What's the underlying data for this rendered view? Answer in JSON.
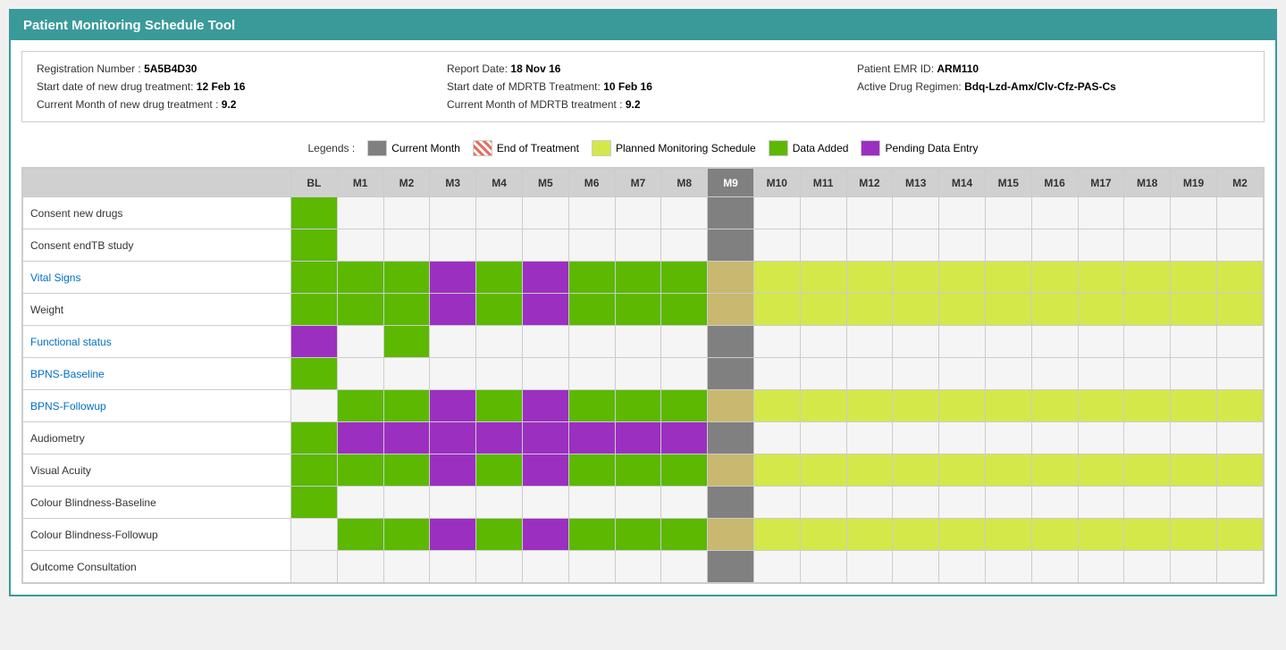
{
  "app": {
    "title": "Patient Monitoring Schedule Tool"
  },
  "info": {
    "registration_label": "Registration Number :",
    "registration_value": "5A5B4D30",
    "report_date_label": "Report Date:",
    "report_date_value": "18 Nov 16",
    "patient_emr_label": "Patient EMR ID:",
    "patient_emr_value": "ARM110",
    "start_new_drug_label": "Start date of new drug treatment:",
    "start_new_drug_value": "12 Feb 16",
    "start_mdrtb_label": "Start date of MDRTB Treatment:",
    "start_mdrtb_value": "10 Feb 16",
    "active_drug_label": "Active Drug Regimen:",
    "active_drug_value": "Bdq-Lzd-Amx/Clv-Cfz-PAS-Cs",
    "current_month_new_label": "Current Month of new drug treatment :",
    "current_month_new_value": "9.2",
    "current_month_mdrtb_label": "Current Month of MDRTB treatment :",
    "current_month_mdrtb_value": "9.2"
  },
  "legends": {
    "label": "Legends :",
    "items": [
      {
        "id": "current-month",
        "label": "Current Month",
        "class": "current-month"
      },
      {
        "id": "end-of-treatment",
        "label": "End of Treatment",
        "class": "end-of-treatment"
      },
      {
        "id": "planned",
        "label": "Planned Monitoring Schedule",
        "class": "planned"
      },
      {
        "id": "data-added",
        "label": "Data Added",
        "class": "data-added"
      },
      {
        "id": "pending",
        "label": "Pending Data Entry",
        "class": "pending"
      }
    ]
  },
  "columns": [
    "BL",
    "M1",
    "M2",
    "M3",
    "M4",
    "M5",
    "M6",
    "M7",
    "M8",
    "M9",
    "M10",
    "M11",
    "M12",
    "M13",
    "M14",
    "M15",
    "M16",
    "M17",
    "M18",
    "M19",
    "M2"
  ],
  "rows": [
    {
      "label": "Consent new drugs",
      "color": "black",
      "cells": [
        "green",
        "empty",
        "empty",
        "empty",
        "empty",
        "empty",
        "empty",
        "empty",
        "empty",
        "gray",
        "empty",
        "empty",
        "empty",
        "empty",
        "empty",
        "empty",
        "empty",
        "empty",
        "empty",
        "empty",
        "empty"
      ]
    },
    {
      "label": "Consent endTB study",
      "color": "black",
      "cells": [
        "green",
        "empty",
        "empty",
        "empty",
        "empty",
        "empty",
        "empty",
        "empty",
        "empty",
        "gray",
        "empty",
        "empty",
        "empty",
        "empty",
        "empty",
        "empty",
        "empty",
        "empty",
        "empty",
        "empty",
        "empty"
      ]
    },
    {
      "label": "Vital Signs",
      "color": "blue",
      "cells": [
        "green",
        "green",
        "green",
        "purple",
        "green",
        "purple",
        "green",
        "green",
        "green",
        "tan",
        "lime",
        "lime",
        "lime",
        "lime",
        "lime",
        "lime",
        "lime",
        "lime",
        "lime",
        "lime",
        "lime"
      ]
    },
    {
      "label": "Weight",
      "color": "black",
      "cells": [
        "green",
        "green",
        "green",
        "purple",
        "green",
        "purple",
        "green",
        "green",
        "green",
        "tan",
        "lime",
        "lime",
        "lime",
        "lime",
        "lime",
        "lime",
        "lime",
        "lime",
        "lime",
        "lime",
        "lime"
      ]
    },
    {
      "label": "Functional status",
      "color": "blue",
      "cells": [
        "purple",
        "empty",
        "green",
        "empty",
        "empty",
        "empty",
        "empty",
        "empty",
        "empty",
        "gray",
        "empty",
        "empty",
        "empty",
        "empty",
        "empty",
        "empty",
        "empty",
        "empty",
        "empty",
        "empty",
        "empty"
      ]
    },
    {
      "label": "BPNS-Baseline",
      "color": "blue",
      "cells": [
        "green",
        "empty",
        "empty",
        "empty",
        "empty",
        "empty",
        "empty",
        "empty",
        "empty",
        "gray",
        "empty",
        "empty",
        "empty",
        "empty",
        "empty",
        "empty",
        "empty",
        "empty",
        "empty",
        "empty",
        "empty"
      ]
    },
    {
      "label": "BPNS-Followup",
      "color": "blue",
      "cells": [
        "empty",
        "green",
        "green",
        "purple",
        "green",
        "purple",
        "green",
        "green",
        "green",
        "tan",
        "lime",
        "lime",
        "lime",
        "lime",
        "lime",
        "lime",
        "lime",
        "lime",
        "lime",
        "lime",
        "lime"
      ]
    },
    {
      "label": "Audiometry",
      "color": "black",
      "cells": [
        "green",
        "purple",
        "purple",
        "purple",
        "purple",
        "purple",
        "purple",
        "purple",
        "purple",
        "gray",
        "empty",
        "empty",
        "empty",
        "empty",
        "empty",
        "empty",
        "empty",
        "empty",
        "empty",
        "empty",
        "empty"
      ]
    },
    {
      "label": "Visual Acuity",
      "color": "black",
      "cells": [
        "green",
        "green",
        "green",
        "purple",
        "green",
        "purple",
        "green",
        "green",
        "green",
        "tan",
        "lime",
        "lime",
        "lime",
        "lime",
        "lime",
        "lime",
        "lime",
        "lime",
        "lime",
        "lime",
        "lime"
      ]
    },
    {
      "label": "Colour Blindness-Baseline",
      "color": "black",
      "cells": [
        "green",
        "empty",
        "empty",
        "empty",
        "empty",
        "empty",
        "empty",
        "empty",
        "empty",
        "gray",
        "empty",
        "empty",
        "empty",
        "empty",
        "empty",
        "empty",
        "empty",
        "empty",
        "empty",
        "empty",
        "empty"
      ]
    },
    {
      "label": "Colour Blindness-Followup",
      "color": "black",
      "cells": [
        "empty",
        "green",
        "green",
        "purple",
        "green",
        "purple",
        "green",
        "green",
        "green",
        "tan",
        "lime",
        "lime",
        "lime",
        "lime",
        "lime",
        "lime",
        "lime",
        "lime",
        "lime",
        "lime",
        "lime"
      ]
    },
    {
      "label": "Outcome Consultation",
      "color": "black",
      "cells": [
        "empty",
        "empty",
        "empty",
        "empty",
        "empty",
        "empty",
        "empty",
        "empty",
        "empty",
        "gray",
        "empty",
        "empty",
        "empty",
        "empty",
        "empty",
        "empty",
        "empty",
        "empty",
        "empty",
        "empty",
        "empty"
      ]
    }
  ]
}
